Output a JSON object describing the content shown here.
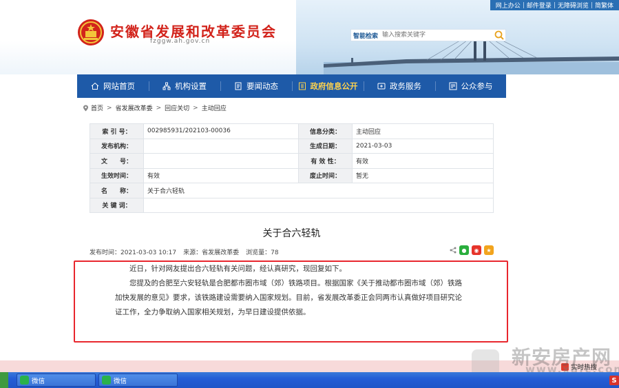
{
  "top_links": [
    "网上办公",
    "邮件登录",
    "无障碍浏览",
    "简繁体"
  ],
  "site": {
    "title": "安徽省发展和改革委员会",
    "domain": "fzggw.ah.gov.cn"
  },
  "search": {
    "label": "智能检索",
    "placeholder": "输入搜索关键字"
  },
  "nav": [
    {
      "label": "网站首页",
      "icon": "home-icon"
    },
    {
      "label": "机构设置",
      "icon": "org-icon"
    },
    {
      "label": "要闻动态",
      "icon": "news-icon"
    },
    {
      "label": "政府信息公开",
      "icon": "info-icon",
      "active": true
    },
    {
      "label": "政务服务",
      "icon": "service-icon"
    },
    {
      "label": "公众参与",
      "icon": "participate-icon"
    }
  ],
  "breadcrumb": [
    "首页",
    "省发展改革委",
    "回应关切",
    "主动回应"
  ],
  "meta": {
    "rows": [
      {
        "k1": "索 引 号：",
        "v1": "002985931/202103-00036",
        "k2": "信息分类：",
        "v2": "主动回应"
      },
      {
        "k1": "发布机构：",
        "v1": "",
        "k2": "生成日期：",
        "v2": "2021-03-03"
      },
      {
        "k1": "文　　号：",
        "v1": "",
        "k2": "有 效 性：",
        "v2": "有效"
      },
      {
        "k1": "生效时间：",
        "v1": "有效",
        "k2": "废止时间：",
        "v2": "暂无"
      }
    ],
    "name_label": "名　　称：",
    "name_value": "关于合六轻轨",
    "keywords_label": "关 键 词：",
    "keywords_value": ""
  },
  "doc": {
    "title": "关于合六轻轨",
    "publish_time": "发布时间：2021-03-03 10:17",
    "source": "来源：省发展改革委",
    "views": "浏览量：78",
    "paragraphs": [
      "近日，针对网友提出合六轻轨有关问题，经认真研究，现回复如下。",
      "您提及的合肥至六安轻轨是合肥都市圈市域（郊）铁路项目。根据国家《关于推动都市圈市域（郊）铁路加快发展的意见》要求，该铁路建设需要纳入国家规划。目前，省发展改革委正会同两市认真做好项目研究论证工作，全力争取纳入国家相关规划，为早日建设提供依据。"
    ]
  },
  "watermark": {
    "text": "新安房产网",
    "url": "www.xafc.com"
  },
  "hot_search": "实时热搜",
  "taskbar": {
    "items": [
      "微信",
      "微信"
    ]
  },
  "colors": {
    "nav_bg": "#1e5aa8",
    "title_red": "#d2231b",
    "highlight_box": "#e8262d",
    "active_nav": "#ffd34d"
  }
}
